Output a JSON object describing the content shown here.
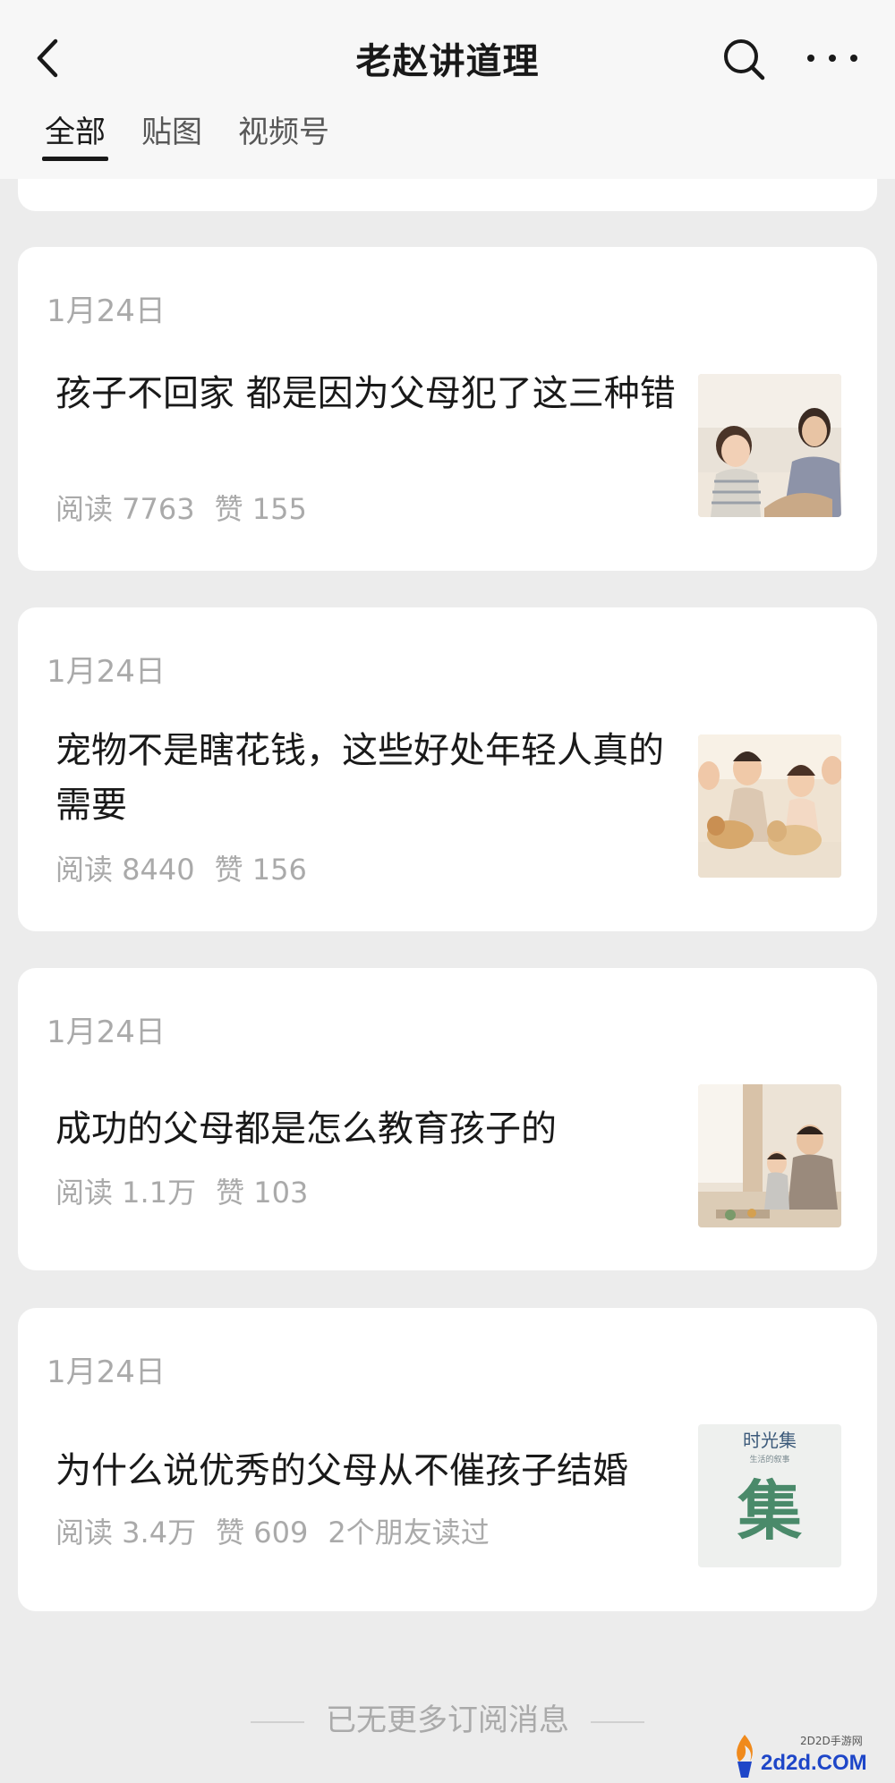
{
  "header": {
    "title": "老赵讲道理",
    "tabs": [
      {
        "label": "全部",
        "active": true
      },
      {
        "label": "贴图",
        "active": false
      },
      {
        "label": "视频号",
        "active": false
      }
    ]
  },
  "articles": [
    {
      "date": "1月24日",
      "title": "孩子不回家 都是因为父母犯了这三种错",
      "reads": "阅读 7763",
      "likes": "赞 155",
      "friends": ""
    },
    {
      "date": "1月24日",
      "title": "宠物不是瞎花钱，这些好处年轻人真的需要",
      "reads": "阅读 8440",
      "likes": "赞 156",
      "friends": ""
    },
    {
      "date": "1月24日",
      "title": "成功的父母都是怎么教育孩子的",
      "reads": "阅读 1.1万",
      "likes": "赞 103",
      "friends": ""
    },
    {
      "date": "1月24日",
      "title": "为什么说优秀的父母从不催孩子结婚",
      "reads": "阅读 3.4万",
      "likes": "赞 609",
      "friends": "2个朋友读过"
    }
  ],
  "thumb4": {
    "title": "时光集",
    "subtitle": "生活的叙事",
    "logo": "集"
  },
  "footer": {
    "text": "已无更多订阅消息"
  },
  "watermark": {
    "main": "2d2d.COM",
    "sub": "2D2D手游网"
  },
  "colors": {
    "background": "#ececec",
    "card": "#ffffff",
    "meta_text": "#aaaaaa",
    "title_text": "#191919",
    "logo_green": "#4a8a6a"
  },
  "icons": [
    "chevron-left-icon",
    "search-icon",
    "more-horizontal-icon"
  ]
}
